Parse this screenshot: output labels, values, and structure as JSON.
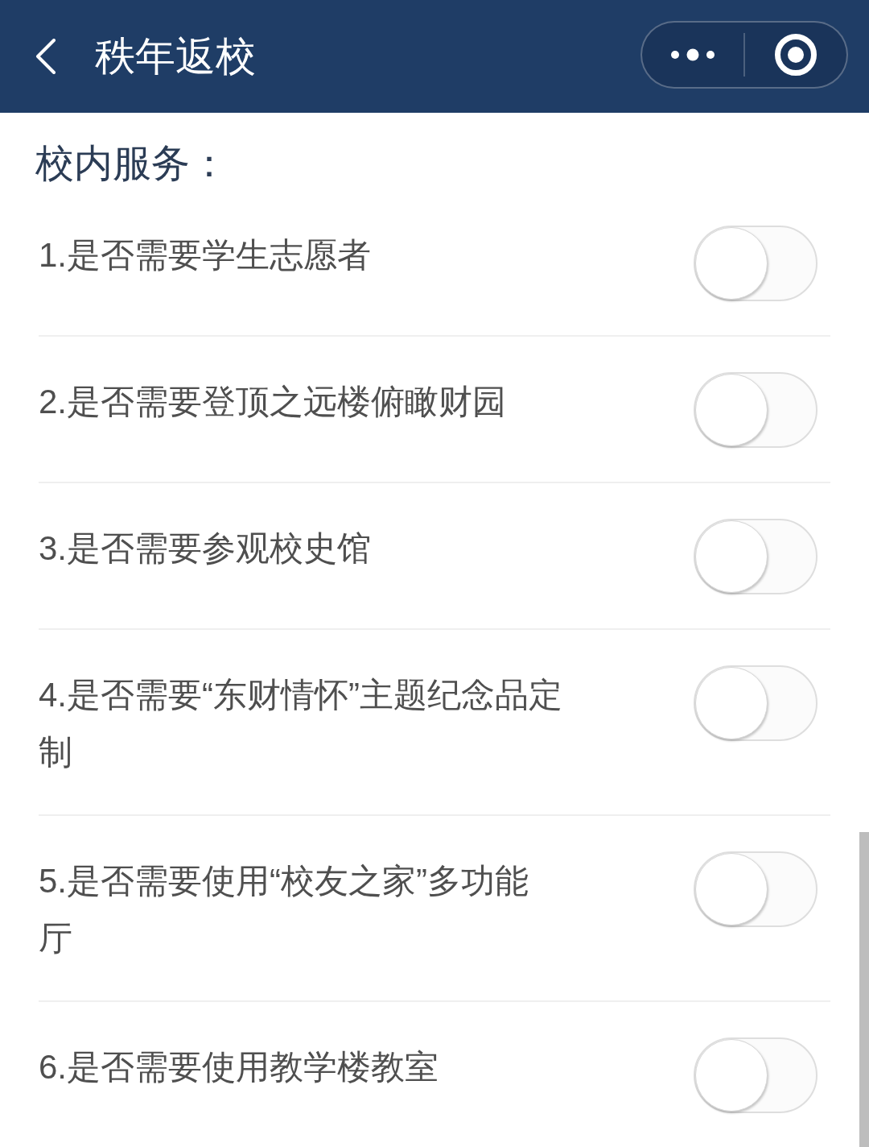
{
  "header": {
    "title": "秩年返校"
  },
  "section": {
    "title": "校内服务："
  },
  "items": [
    {
      "label": "1.是否需要学生志愿者",
      "on": false
    },
    {
      "label": "2.是否需要登顶之远楼俯瞰财园",
      "on": false
    },
    {
      "label": "3.是否需要参观校史馆",
      "on": false
    },
    {
      "label": "4.是否需要“东财情怀”主题纪念品定制",
      "on": false
    },
    {
      "label": "5.是否需要使用“校友之家”多功能厅",
      "on": false
    },
    {
      "label": "6.是否需要使用教学楼教室",
      "on": false
    }
  ]
}
